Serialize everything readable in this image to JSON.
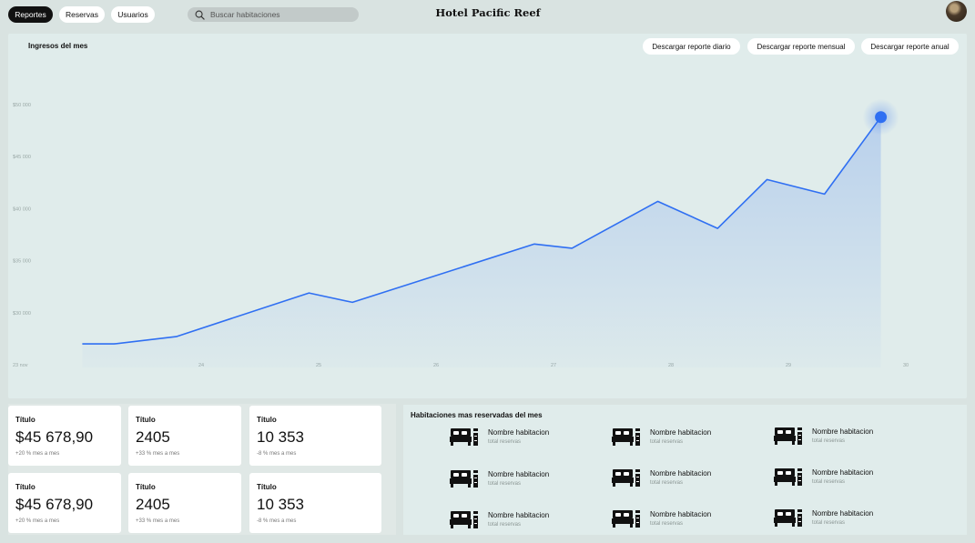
{
  "nav": {
    "items": [
      "Reportes",
      "Reservas",
      "Usuarios"
    ],
    "active": "Reportes"
  },
  "search": {
    "placeholder": "Buscar habitaciones"
  },
  "header": {
    "title": "Hotel Pacific Reef"
  },
  "chart_panel": {
    "title": "Ingresos del mes",
    "buttons": [
      "Descargar reporte diario",
      "Descargar reporte mensual",
      "Descargar reporte anual"
    ]
  },
  "chart_data": {
    "type": "area",
    "title": "Ingresos del mes",
    "xlabel": "",
    "ylabel": "",
    "x_ticks": [
      "23 nov",
      "24",
      "25",
      "26",
      "27",
      "28",
      "29",
      "30"
    ],
    "y_ticks": [
      "$30 000",
      "$35 000",
      "$40 000",
      "$45 000",
      "$50 000"
    ],
    "ylim": [
      25000,
      50000
    ],
    "xlim": [
      23,
      30.4
    ],
    "grid": false,
    "accent": "#2f6ff2",
    "series": [
      {
        "x": [
          23.6,
          23.87,
          24.4,
          25.53,
          25.9,
          27.45,
          27.77,
          28.5,
          29.01,
          29.43,
          29.92,
          30.4
        ],
        "values": [
          27000,
          27000,
          27700,
          31900,
          31000,
          36600,
          36200,
          40700,
          38100,
          42800,
          41400,
          48800
        ]
      }
    ]
  },
  "stats": [
    {
      "title": "Título",
      "value": "$45 678,90",
      "sub": "+20 % mes a mes"
    },
    {
      "title": "Título",
      "value": "2405",
      "sub": "+33 % mes a mes"
    },
    {
      "title": "Título",
      "value": "10 353",
      "sub": "-8 % mes a mes"
    },
    {
      "title": "Título",
      "value": "$45 678,90",
      "sub": "+20 % mes a mes"
    },
    {
      "title": "Título",
      "value": "2405",
      "sub": "+33 % mes a mes"
    },
    {
      "title": "Título",
      "value": "10 353",
      "sub": "-8 % mes a mes"
    }
  ],
  "rooms_panel": {
    "title": "Habitaciones mas reservadas del mes",
    "rooms": [
      {
        "name": "Nombre habitacion",
        "sub": "total reservas",
        "icon": "bed-icon"
      },
      {
        "name": "Nombre habitacion",
        "sub": "total reservas",
        "icon": "bed-icon"
      },
      {
        "name": "Nombre habitacion",
        "sub": "total reservas",
        "icon": "bed-icon"
      },
      {
        "name": "Nombre habitacion",
        "sub": "total reservas",
        "icon": "bed-icon"
      },
      {
        "name": "Nombre habitacion",
        "sub": "total reservas",
        "icon": "bed-icon"
      },
      {
        "name": "Nombre habitacion",
        "sub": "total reservas",
        "icon": "bed-icon"
      },
      {
        "name": "Nombre habitacion",
        "sub": "total reservas",
        "icon": "bed-icon"
      },
      {
        "name": "Nombre habitacion",
        "sub": "total reservas",
        "icon": "bed-icon"
      },
      {
        "name": "Nombre habitacion",
        "sub": "total reservas",
        "icon": "bed-icon"
      }
    ]
  }
}
